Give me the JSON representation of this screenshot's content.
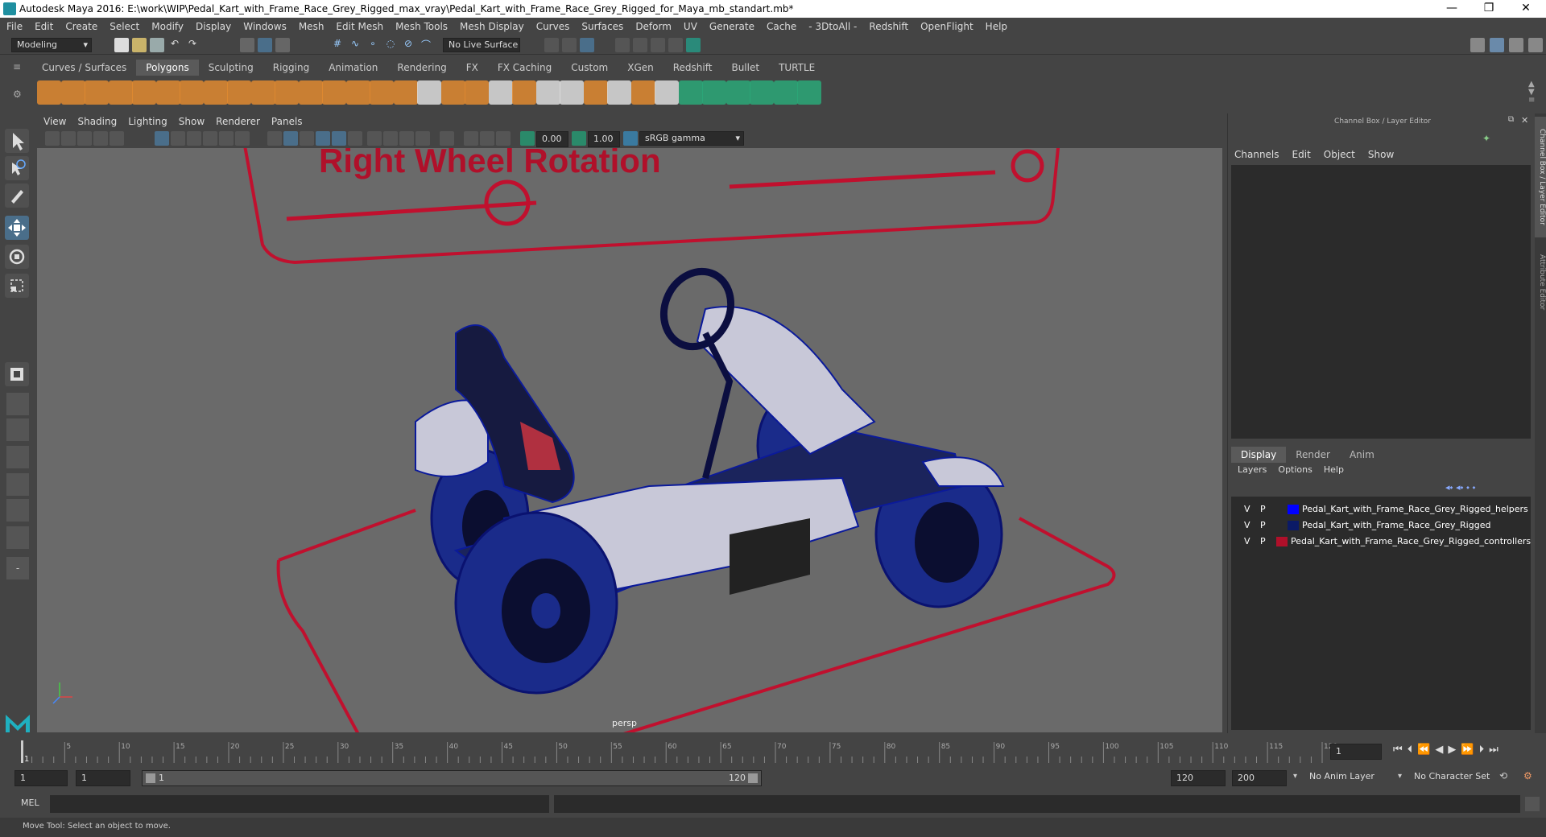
{
  "window": {
    "title": "Autodesk Maya 2016: E:\\work\\WIP\\Pedal_Kart_with_Frame_Race_Grey_Rigged_max_vray\\Pedal_Kart_with_Frame_Race_Grey_Rigged_for_Maya_mb_standart.mb*"
  },
  "menubar": [
    "File",
    "Edit",
    "Create",
    "Select",
    "Modify",
    "Display",
    "Windows",
    "Mesh",
    "Edit Mesh",
    "Mesh Tools",
    "Mesh Display",
    "Curves",
    "Surfaces",
    "Deform",
    "UV",
    "Generate",
    "Cache",
    "- 3DtoAll -",
    "Redshift",
    "OpenFlight",
    "Help"
  ],
  "status": {
    "mode": "Modeling",
    "live_surface": "No Live Surface"
  },
  "shelf_tabs": [
    "Curves / Surfaces",
    "Polygons",
    "Sculpting",
    "Rigging",
    "Animation",
    "Rendering",
    "FX",
    "FX Caching",
    "Custom",
    "XGen",
    "Redshift",
    "Bullet",
    "TURTLE"
  ],
  "shelf_active": "Polygons",
  "viewport": {
    "menu": [
      "View",
      "Shading",
      "Lighting",
      "Show",
      "Renderer",
      "Panels"
    ],
    "exposure": "0.00",
    "gamma": "1.00",
    "colorspace": "sRGB gamma",
    "camera": "persp",
    "label_text": "Right Wheel Rotation"
  },
  "channel_box": {
    "title": "Channel Box / Layer Editor",
    "menu": [
      "Channels",
      "Edit",
      "Object",
      "Show"
    ],
    "layer_tabs": [
      "Display",
      "Render",
      "Anim"
    ],
    "layer_active": "Display",
    "layer_menu": [
      "Layers",
      "Options",
      "Help"
    ],
    "layers": [
      {
        "v": "V",
        "p": "P",
        "color": "#0000ff",
        "name": "Pedal_Kart_with_Frame_Race_Grey_Rigged_helpers"
      },
      {
        "v": "V",
        "p": "P",
        "color": "#0b1a66",
        "name": "Pedal_Kart_with_Frame_Race_Grey_Rigged"
      },
      {
        "v": "V",
        "p": "P",
        "color": "#b0102a",
        "name": "Pedal_Kart_with_Frame_Race_Grey_Rigged_controllers"
      }
    ]
  },
  "side_tabs": [
    "Channel Box / Layer Editor",
    "Attribute Editor"
  ],
  "timeline": {
    "ticks": [
      "5",
      "10",
      "15",
      "20",
      "25",
      "30",
      "35",
      "40",
      "45",
      "50",
      "55",
      "60",
      "65",
      "70",
      "75",
      "80",
      "85",
      "90",
      "95",
      "100",
      "105",
      "110",
      "115",
      "120"
    ],
    "current": "1",
    "current_field": "1"
  },
  "range": {
    "start": "1",
    "start2": "1",
    "slider_start": "1",
    "slider_end": "120",
    "end": "120",
    "end2": "200",
    "anim_layer": "No Anim Layer",
    "char_set": "No Character Set"
  },
  "cmd": {
    "lang": "MEL"
  },
  "help": {
    "text": "Move Tool: Select an object to move."
  },
  "colors": {
    "accent": "#4a6e8a",
    "controller_red": "#b0102a",
    "wire_blue": "#0b1a9a"
  }
}
